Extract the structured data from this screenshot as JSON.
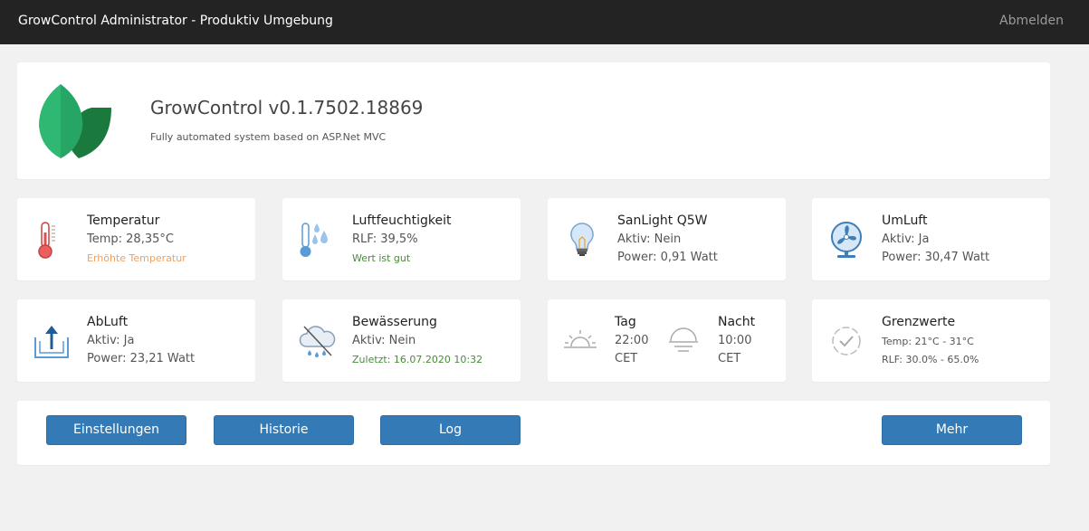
{
  "navbar": {
    "brand": "GrowControl Administrator - Produktiv Umgebung",
    "logout": "Abmelden"
  },
  "header": {
    "title": "GrowControl v0.1.7502.18869",
    "subtitle": "Fully automated system based on ASP.Net MVC",
    "logo_icon": "leaf-logo-icon",
    "logo_colors": [
      "#2eb872",
      "#1a7a3e"
    ]
  },
  "cards": {
    "temperatur": {
      "icon": "thermometer-icon",
      "title": "Temperatur",
      "line1": "Temp: 28,35°C",
      "line2": "Erhöhte Temperatur"
    },
    "luftfeuchtigkeit": {
      "icon": "humidity-icon",
      "title": "Luftfeuchtigkeit",
      "line1": "RLF: 39,5%",
      "line2": "Wert ist gut"
    },
    "sanlight": {
      "icon": "lightbulb-icon",
      "title": "SanLight Q5W",
      "line1": "Aktiv: Nein",
      "line2": "Power: 0,91 Watt"
    },
    "umluft": {
      "icon": "fan-icon",
      "title": "UmLuft",
      "line1": "Aktiv: Ja",
      "line2": "Power: 30,47 Watt"
    },
    "abluft": {
      "icon": "exhaust-icon",
      "title": "AbLuft",
      "line1": "Aktiv: Ja",
      "line2": "Power: 23,21 Watt"
    },
    "bewaesserung": {
      "icon": "rain-cloud-icon",
      "title": "Bewässerung",
      "line1": "Aktiv: Nein",
      "line2": "Zuletzt: 16.07.2020 10:32"
    },
    "tagnacht": {
      "tag_icon": "sunrise-icon",
      "nacht_icon": "sunset-icon",
      "tag_title": "Tag",
      "tag_time": "22:00",
      "tag_tz": "CET",
      "nacht_title": "Nacht",
      "nacht_time": "10:00",
      "nacht_tz": "CET"
    },
    "grenzwerte": {
      "icon": "check-circle-icon",
      "title": "Grenzwerte",
      "line1": "Temp: 21°C - 31°C",
      "line2": "RLF: 30.0% - 65.0%"
    }
  },
  "buttons": {
    "einstellungen": "Einstellungen",
    "historie": "Historie",
    "log": "Log",
    "mehr": "Mehr"
  },
  "colors": {
    "navbar_bg": "#232323",
    "button_primary": "#337ab7",
    "warning_text": "#f0a060",
    "ok_text": "#4a8a3c",
    "icon_blue": "#5b9bd5",
    "icon_red": "#e05050"
  }
}
